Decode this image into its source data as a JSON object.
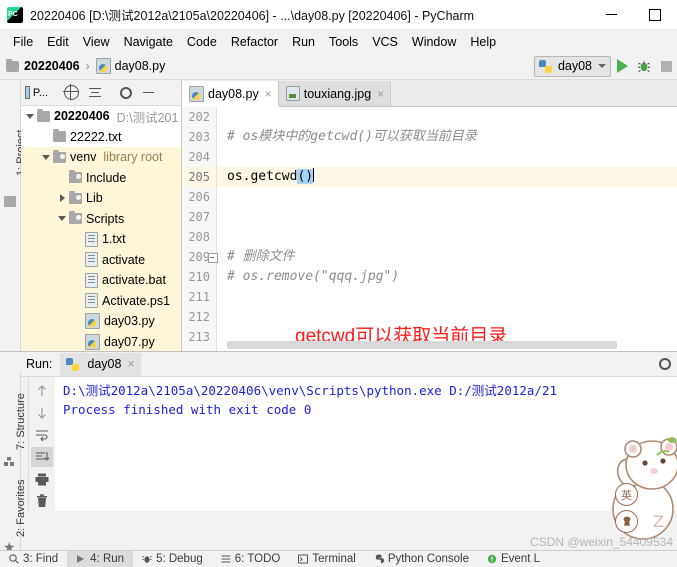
{
  "window": {
    "title": "20220406 [D:\\测试2012a\\2105a\\20220406] - ...\\day08.py [20220406] - PyCharm",
    "app_icon": "pycharm-logo-icon",
    "minimize": "minimize-icon",
    "maximize": "maximize-icon"
  },
  "menu": {
    "items": [
      {
        "label": "File"
      },
      {
        "label": "Edit"
      },
      {
        "label": "View"
      },
      {
        "label": "Navigate"
      },
      {
        "label": "Code"
      },
      {
        "label": "Refactor"
      },
      {
        "label": "Run"
      },
      {
        "label": "Tools"
      },
      {
        "label": "VCS"
      },
      {
        "label": "Window"
      },
      {
        "label": "Help"
      }
    ]
  },
  "navbar": {
    "breadcrumb": [
      "20220406",
      "day08.py"
    ],
    "separator": "›",
    "run_config": "day08",
    "buttons": [
      "run-button",
      "debug-button",
      "stop-button"
    ]
  },
  "project_panel": {
    "selector_label": "P...",
    "toolbar_icons": [
      "project-selector",
      "locate-icon",
      "collapse-all-icon",
      "settings-gear-icon",
      "hide-icon"
    ],
    "tree": [
      {
        "label": "20220406",
        "hint": "D:\\测试201",
        "indent": 0,
        "arrow": "down",
        "icon": "folder-icon",
        "bold": true,
        "highlight": false
      },
      {
        "label": "22222.txt",
        "hint": "",
        "indent": 1,
        "arrow": "none",
        "icon": "folder-icon",
        "bold": false,
        "highlight": false
      },
      {
        "label": "venv",
        "hint": "library root",
        "indent": 1,
        "arrow": "down",
        "icon": "library-folder-icon",
        "bold": false,
        "highlight": true
      },
      {
        "label": "Include",
        "hint": "",
        "indent": 2,
        "arrow": "none",
        "icon": "library-folder-icon",
        "bold": false,
        "highlight": true
      },
      {
        "label": "Lib",
        "hint": "",
        "indent": 2,
        "arrow": "right",
        "icon": "library-folder-icon",
        "bold": false,
        "highlight": true
      },
      {
        "label": "Scripts",
        "hint": "",
        "indent": 2,
        "arrow": "down",
        "icon": "library-folder-icon",
        "bold": false,
        "highlight": true
      },
      {
        "label": "1.txt",
        "hint": "",
        "indent": 3,
        "arrow": "none",
        "icon": "text-file-icon",
        "bold": false,
        "highlight": true
      },
      {
        "label": "activate",
        "hint": "",
        "indent": 3,
        "arrow": "none",
        "icon": "text-file-icon",
        "bold": false,
        "highlight": true
      },
      {
        "label": "activate.bat",
        "hint": "",
        "indent": 3,
        "arrow": "none",
        "icon": "text-file-icon",
        "bold": false,
        "highlight": true
      },
      {
        "label": "Activate.ps1",
        "hint": "",
        "indent": 3,
        "arrow": "none",
        "icon": "text-file-icon",
        "bold": false,
        "highlight": true
      },
      {
        "label": "day03.py",
        "hint": "",
        "indent": 3,
        "arrow": "none",
        "icon": "python-file-icon",
        "bold": false,
        "highlight": true
      },
      {
        "label": "day07.py",
        "hint": "",
        "indent": 3,
        "arrow": "none",
        "icon": "python-file-icon",
        "bold": false,
        "highlight": true
      }
    ]
  },
  "editor": {
    "tabs": [
      {
        "label": "day08.py",
        "icon": "python-file-icon",
        "active": true,
        "close": "×"
      },
      {
        "label": "touxiang.jpg",
        "icon": "image-file-icon",
        "active": false,
        "close": "×"
      }
    ],
    "line_numbers": [
      "202",
      "203",
      "204",
      "205",
      "206",
      "207",
      "208",
      "209",
      "210",
      "211",
      "212",
      "213"
    ],
    "current_line": "205",
    "lines": [
      {
        "num": "202",
        "text": "",
        "kind": "blank"
      },
      {
        "num": "203",
        "text": "# os模块中的getcwd()可以获取当前目录",
        "kind": "comment"
      },
      {
        "num": "204",
        "text": "",
        "kind": "blank"
      },
      {
        "num": "205",
        "text": "os.getcwd",
        "selected": "()",
        "kind": "code-current"
      },
      {
        "num": "206",
        "text": "",
        "kind": "blank"
      },
      {
        "num": "207",
        "text": "",
        "kind": "blank"
      },
      {
        "num": "208",
        "text": "",
        "kind": "blank"
      },
      {
        "num": "209",
        "text": "# 删除文件",
        "kind": "comment-fold"
      },
      {
        "num": "210",
        "text": "# os.remove(\"qqq.jpg\")",
        "kind": "comment"
      },
      {
        "num": "211",
        "text": "",
        "kind": "blank"
      },
      {
        "num": "212",
        "text": "",
        "kind": "blank"
      },
      {
        "num": "213",
        "text": "",
        "kind": "blank"
      }
    ],
    "annotation": "getcwd可以获取当前目录",
    "annotation_color": "#ff1a1a"
  },
  "left_strip": {
    "top_label": "1: Project",
    "labels": [
      "7: Structure",
      "2: Favorites"
    ]
  },
  "run_panel": {
    "label": "Run:",
    "tab_label": "day08",
    "tab_close": "×",
    "settings_icon": "settings-gear-icon",
    "tool_icons_left": [
      "rerun-icon",
      "stop-icon",
      "layout-icon",
      "pin-icon"
    ],
    "tool_icons_right": [
      "up-icon",
      "down-icon",
      "soft-wrap-icon",
      "scroll-to-end-icon",
      "print-icon",
      "clear-all-icon"
    ],
    "console_lines": [
      "D:\\测试2012a\\2105a\\20220406\\venv\\Scripts\\python.exe D:/测试2012a/21",
      "",
      "Process finished with exit code 0"
    ],
    "console_color": "#2020dd"
  },
  "bottom_bar": {
    "items": [
      {
        "label": "3: Find",
        "icon": "search-icon",
        "active": false
      },
      {
        "label": "4: Run",
        "icon": "run-icon",
        "active": true
      },
      {
        "label": "5: Debug",
        "icon": "debug-icon",
        "active": false
      },
      {
        "label": "6: TODO",
        "icon": "todo-icon",
        "active": false
      },
      {
        "label": "Terminal",
        "icon": "terminal-icon",
        "active": false
      },
      {
        "label": "Python Console",
        "icon": "python-icon",
        "active": false
      },
      {
        "label": "Event L",
        "icon": "event-log-icon",
        "active": false
      }
    ]
  },
  "watermark": "CSDN @weixin_54409534",
  "ime_widget": {
    "mode_label": "英",
    "secondary_icon": "ime-keyboard-icon",
    "mascot": "bear-mascot-icon"
  }
}
